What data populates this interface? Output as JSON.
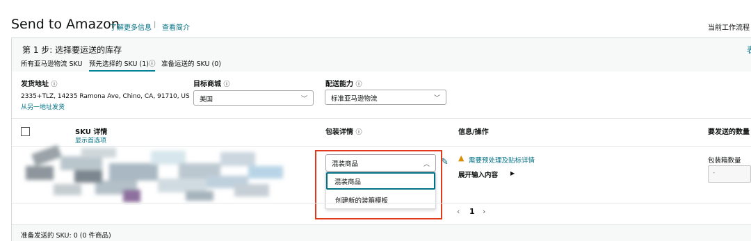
{
  "header": {
    "title": "Send to Amazon",
    "learn_more": "了解更多信息",
    "separator": "|",
    "overview": "查看简介",
    "workflow": "当前工作流程"
  },
  "step": {
    "title": "第 1 步:  选择要运送的库存",
    "right_link": "表"
  },
  "tabs": [
    {
      "label": "所有亚马逊物流 SKU"
    },
    {
      "label": "预先选择的 SKU (1)ⓘ",
      "active": true
    },
    {
      "label": "准备运送的 SKU (0)"
    }
  ],
  "ship_from": {
    "label": "发货地址",
    "info": "ⓘ",
    "address": "2335+TLZ, 14235 Ramona Ave, Chino, CA, 91710, US",
    "link": "从另一地址发货"
  },
  "marketplace": {
    "label": "目标商城",
    "info": "ⓘ",
    "value": "美国"
  },
  "fulfillment": {
    "label": "配送能力",
    "info": "ⓘ",
    "value": "标准亚马逊物流"
  },
  "table": {
    "sku_header": "SKU 详情",
    "sku_sub": "显示首选项",
    "packing_header": "包装详情",
    "packing_info": "ⓘ",
    "info_header": "信息/操作",
    "qty_header": "要发送的数量"
  },
  "row": {
    "packing_value": "混装商品",
    "dropdown_options": [
      "混装商品",
      "创建新的装箱模板"
    ],
    "warning": "需要预处理及贴标详情",
    "expand": "展开输入内容",
    "boxes_label": "包装箱数量",
    "boxes_placeholder": "-"
  },
  "pagination": {
    "prev": "‹",
    "page": "1",
    "next": "›"
  },
  "footer": {
    "text": "准备发送的 SKU:  0  (0 件商品)"
  },
  "colors": {
    "link": "#007185",
    "highlight": "#e0391b",
    "warning": "#d98e04"
  }
}
